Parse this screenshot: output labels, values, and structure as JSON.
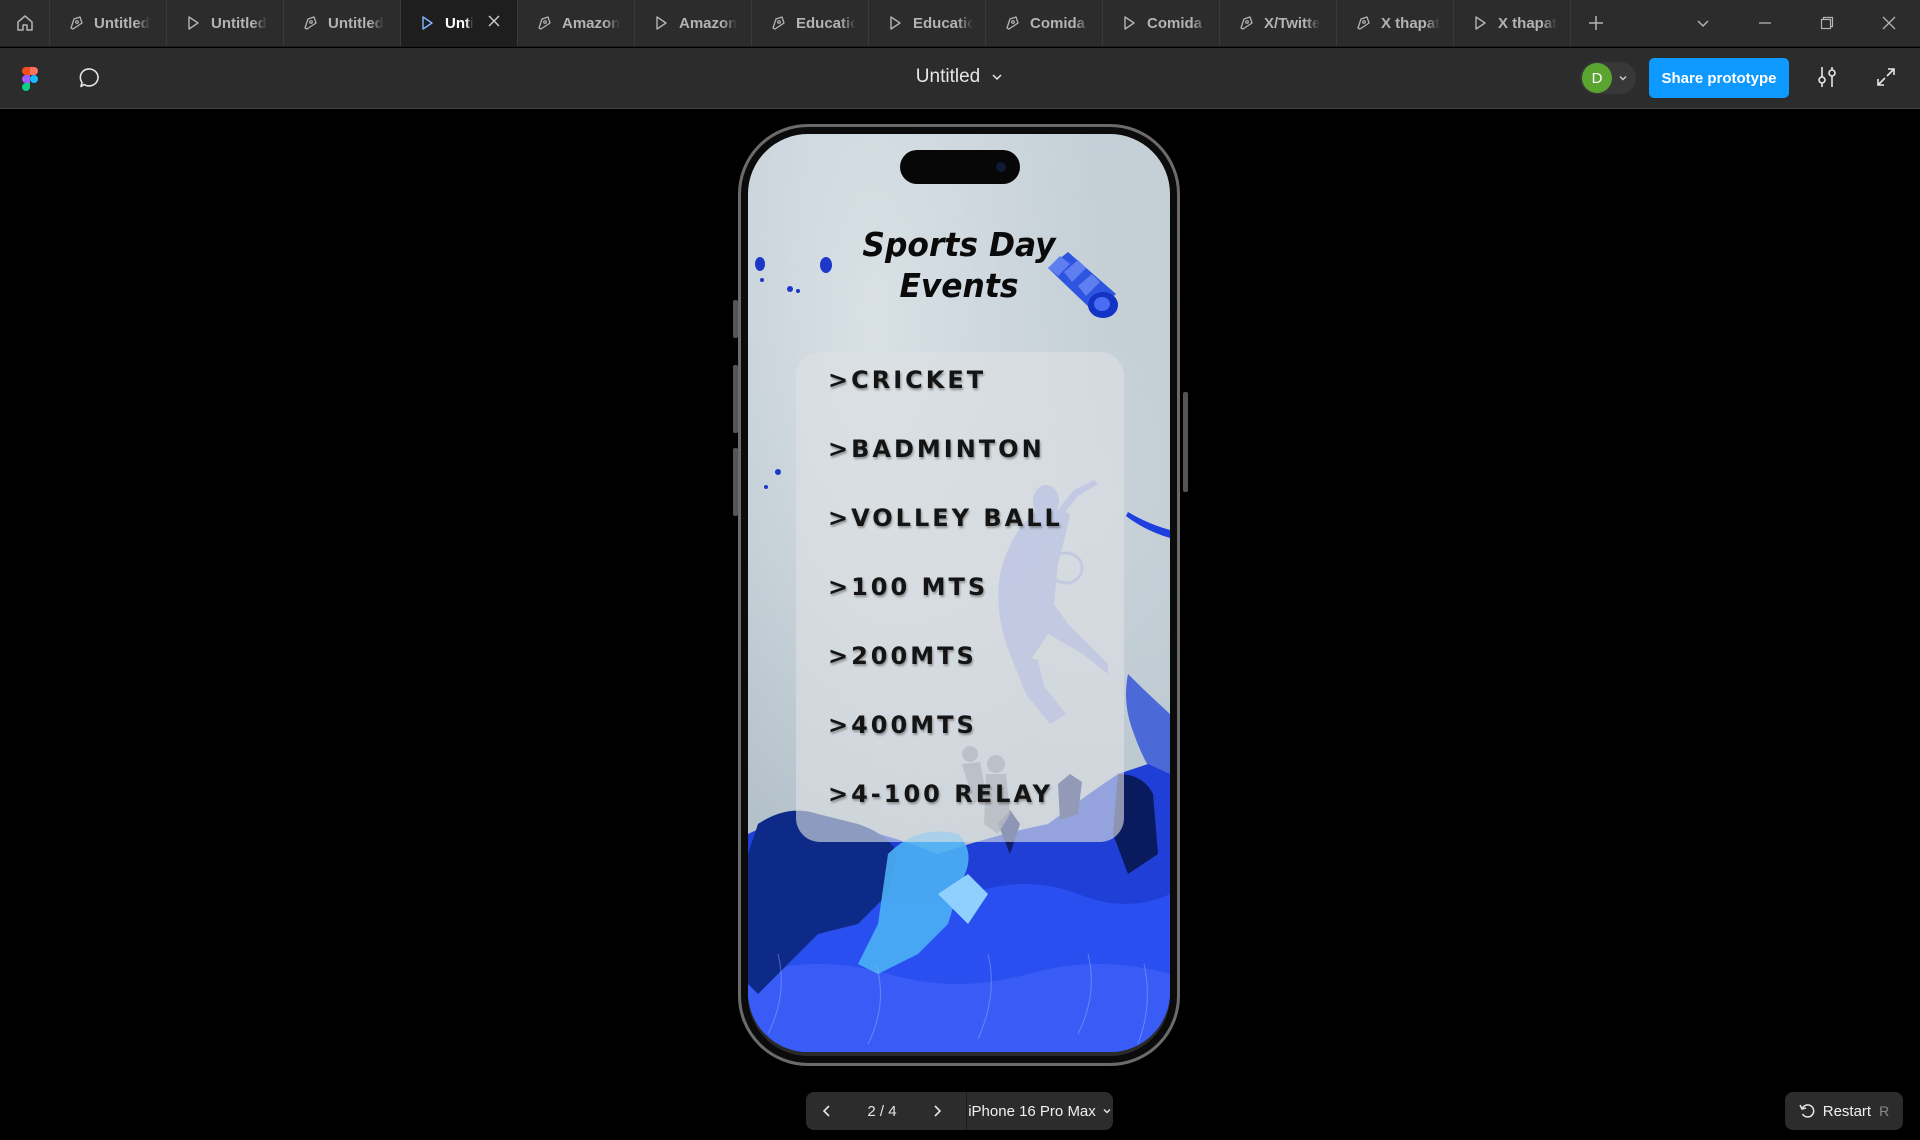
{
  "tabs": [
    {
      "label": "Untitled",
      "icon": "design-file-icon",
      "active": false
    },
    {
      "label": "Untitled",
      "icon": "play-icon",
      "active": false
    },
    {
      "label": "Untitled",
      "icon": "design-file-icon",
      "active": false
    },
    {
      "label": "Untitled",
      "icon": "play-icon",
      "active": true
    },
    {
      "label": "Amazon",
      "icon": "design-file-icon",
      "active": false
    },
    {
      "label": "Amazon",
      "icon": "play-icon",
      "active": false
    },
    {
      "label": "Educatio",
      "icon": "design-file-icon",
      "active": false
    },
    {
      "label": "Educatio",
      "icon": "play-icon",
      "active": false
    },
    {
      "label": "Comida I",
      "icon": "design-file-icon",
      "active": false
    },
    {
      "label": "Comida I",
      "icon": "play-icon",
      "active": false
    },
    {
      "label": "X/Twitte",
      "icon": "design-file-icon",
      "active": false
    },
    {
      "label": "X thapat",
      "icon": "design-file-icon",
      "active": false
    },
    {
      "label": "X thapat",
      "icon": "play-icon",
      "active": false
    }
  ],
  "toolbar": {
    "file_title": "Untitled",
    "avatar_initial": "D",
    "share_label": "Share prototype"
  },
  "screen": {
    "title_line1": "Sports Day",
    "title_line2": "Events",
    "events": [
      ">CRICKET",
      ">BADMINTON",
      ">VOLLEY BALL",
      ">100 MTS",
      ">200MTS",
      ">400MTS",
      ">4-100 RELAY"
    ]
  },
  "pager": {
    "count": "2 / 4",
    "device": "iPhone 16 Pro Max"
  },
  "restart": {
    "label": "Restart",
    "shortcut": "R"
  },
  "colors": {
    "accent": "#0d99ff",
    "avatar": "#5aa530",
    "chrome": "#2c2c2c",
    "art_blue": "#1f3fd6"
  }
}
